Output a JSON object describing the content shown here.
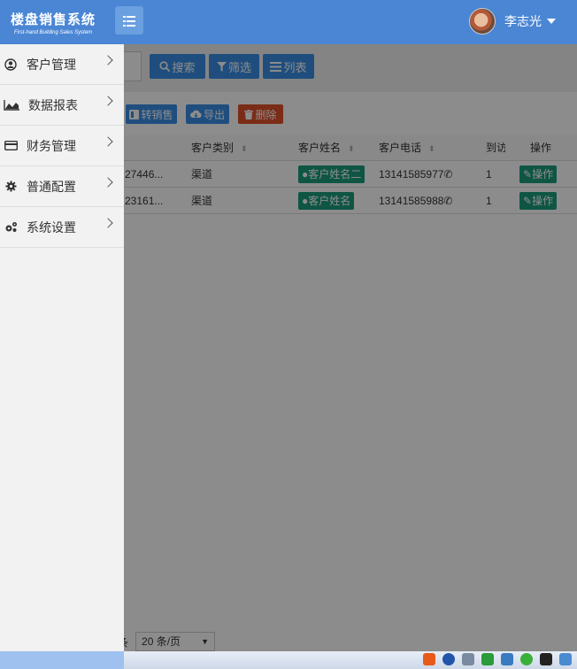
{
  "header": {
    "app_title": "楼盘销售系统",
    "app_subtitle": "First-hand Building Sales System",
    "user_name": "李志光"
  },
  "toolbar": {
    "search_label": "搜索",
    "filter_label": "筛选",
    "list_label": "列表",
    "transfer_label": "转销售",
    "export_label": "导出",
    "delete_label": "删除"
  },
  "table": {
    "columns": [
      "客户类别",
      "客户姓名",
      "客户电话",
      "到访",
      "操作"
    ],
    "rows": [
      {
        "id": "27446...",
        "category": "渠道",
        "name": "客户姓名二",
        "phone": "13141585977",
        "visits": "1",
        "action": "操作"
      },
      {
        "id": "23161...",
        "category": "渠道",
        "name": "客户姓名",
        "phone": "13141585988",
        "visits": "1",
        "action": "操作"
      }
    ]
  },
  "pager": {
    "suffix": "条",
    "page_size": "20 条/页"
  },
  "sidebar": {
    "items": [
      {
        "label": "客户管理",
        "icon": "user-circle-icon"
      },
      {
        "label": "数据报表",
        "icon": "area-chart-icon"
      },
      {
        "label": "财务管理",
        "icon": "credit-card-icon"
      },
      {
        "label": "普通配置",
        "icon": "gear-icon"
      },
      {
        "label": "系统设置",
        "icon": "gears-icon"
      }
    ]
  },
  "colors": {
    "header_bg": "#4a86d4",
    "primary": "#3a8ee6",
    "danger": "#e0502a",
    "success": "#1a9b7c"
  }
}
